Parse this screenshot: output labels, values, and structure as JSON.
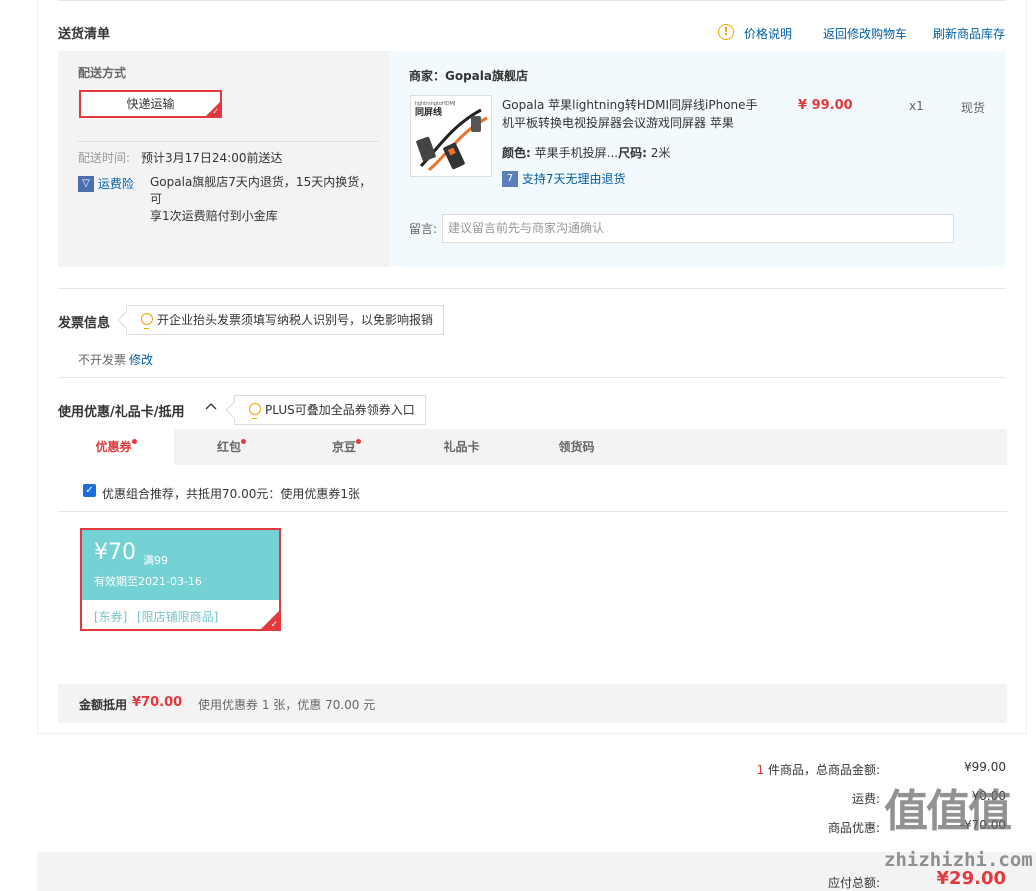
{
  "header": {
    "title": "送货清单",
    "links": [
      "价格说明",
      "返回修改购物车",
      "刷新商品库存"
    ]
  },
  "shipping": {
    "method_label": "配送方式",
    "method_value": "快递运输",
    "time_label": "配送时间:",
    "time_value": "预计3月17日24:00前送达",
    "insurance_label": "运费险",
    "insurance_desc_1": "Gopala旗舰店7天内退货，15天内换货，可",
    "insurance_desc_2": "享1次运费赔付到小金库"
  },
  "store": {
    "name": "商家：Gopala旗舰店",
    "product_title_1": "Gopala 苹果lightning转HDMI同屏线iPhone手",
    "product_title_2": "机平板转换电视投屏器会议游戏同屏器 苹果",
    "thumb_brand": "lightningtoHDMI",
    "thumb_title": "同屏线",
    "price": "¥ 99.00",
    "qty": "x1",
    "stock": "现货",
    "color_label": "颜色:",
    "color_value": "苹果手机投屏...",
    "size_label": "尺码:",
    "size_value": "2米",
    "return_badge": "7",
    "return_text": "支持7天无理由退货",
    "note_label": "留言:",
    "note_placeholder": "建议留言前先与商家沟通确认"
  },
  "invoice": {
    "title": "发票信息",
    "tip": "开企业抬头发票须填写纳税人识别号，以免影响报销",
    "value": "不开发票",
    "edit": "修改"
  },
  "discount": {
    "title": "使用优惠/礼品卡/抵用",
    "tip": "PLUS可叠加全品券领券入口",
    "tabs": [
      "优惠券",
      "红包",
      "京豆",
      "礼品卡",
      "领货码"
    ],
    "combo_text": "优惠组合推荐，共抵用70.00元：使用优惠券1张",
    "coupon": {
      "amount": "¥70",
      "condition": "满99",
      "expiry": "有效期至2021-03-16",
      "tag1": "[东券]",
      "tag2": "[限店铺限商品]"
    },
    "summary_label": "金额抵用",
    "summary_amount": "¥70.00",
    "summary_desc": "使用优惠券 1 张，优惠 70.00 元"
  },
  "totals": {
    "count": "1",
    "count_suffix": "件商品，总商品金额:",
    "goods_amount": "¥99.00",
    "shipping_label": "运费:",
    "shipping_amount": "¥0.00",
    "discount_label": "商品优惠:",
    "discount_amount": "-¥70.00",
    "payable_label": "应付总额:",
    "payable_amount": "¥29.00"
  },
  "watermark": {
    "logo": "值值值",
    "site": "zhizhizhi.com"
  },
  "colors": {
    "accent": "#e4393c",
    "link": "#005ea7",
    "coupon": "#74d2d4"
  }
}
